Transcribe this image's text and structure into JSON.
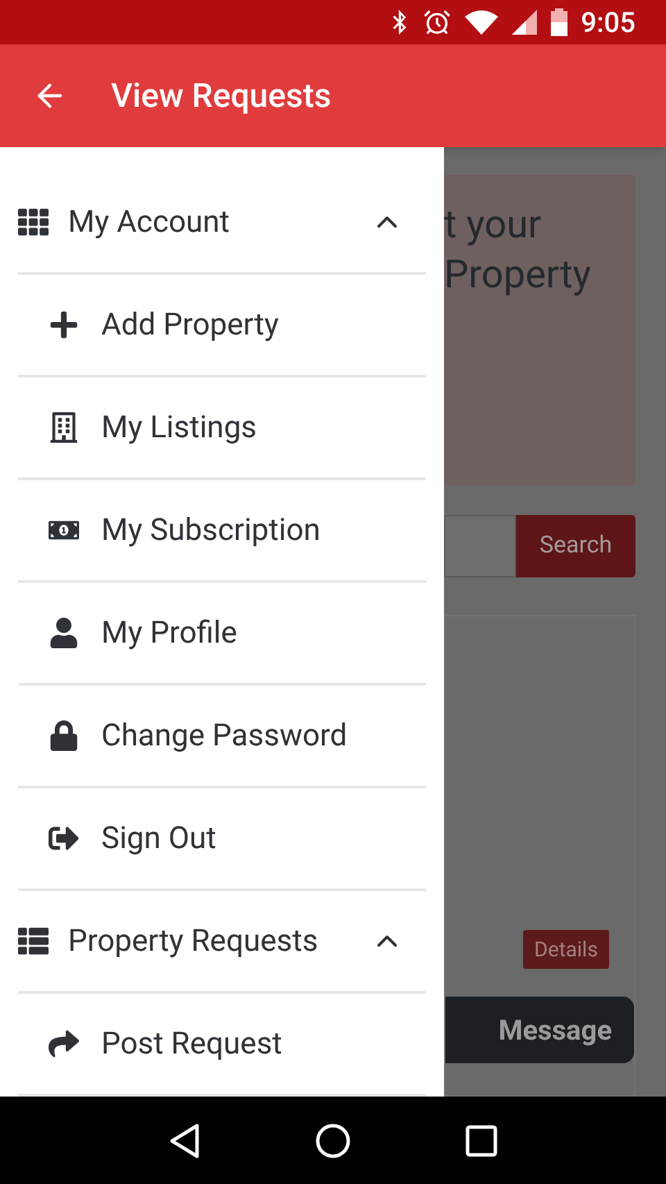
{
  "status_bar": {
    "time": "9:05"
  },
  "app_bar": {
    "title": "View Requests"
  },
  "drawer": {
    "sections": [
      {
        "title": "My Account",
        "kind": "grid",
        "expanded": true,
        "items": [
          {
            "label": "Add Property",
            "kind": "plus"
          },
          {
            "label": "My Listings",
            "kind": "building"
          },
          {
            "label": "My Subscription",
            "kind": "money"
          },
          {
            "label": "My Profile",
            "kind": "user"
          },
          {
            "label": "Change Password",
            "kind": "lock"
          },
          {
            "label": "Sign Out",
            "kind": "signout"
          }
        ]
      },
      {
        "title": "Property Requests",
        "kind": "list",
        "expanded": true,
        "items": [
          {
            "label": "Post Request",
            "kind": "share"
          }
        ]
      }
    ]
  },
  "background_page": {
    "banner_lines": [
      "t your",
      "Property"
    ],
    "search_button": "Search",
    "details_button": "Details",
    "message_button": "Message"
  }
}
